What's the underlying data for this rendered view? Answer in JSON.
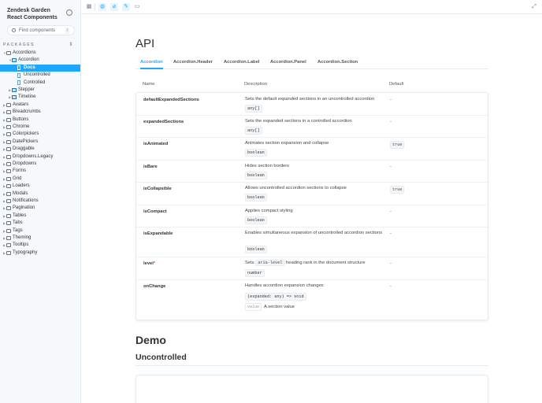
{
  "sidebar": {
    "brand_line1": "Zendesk Garden",
    "brand_line2": "React Components",
    "search_placeholder": "Find components",
    "search_shortcut": "/",
    "packages_label": "PACKAGES",
    "tree": [
      {
        "label": "Accordions",
        "kind": "folder",
        "level": 0,
        "expanded": true
      },
      {
        "label": "Accordion",
        "kind": "component",
        "level": 1,
        "expanded": true
      },
      {
        "label": "Docs",
        "kind": "doc",
        "level": 2,
        "selected": true
      },
      {
        "label": "Uncontrolled",
        "kind": "story",
        "level": 2
      },
      {
        "label": "Controlled",
        "kind": "story",
        "level": 2
      },
      {
        "label": "Stepper",
        "kind": "component",
        "level": 1
      },
      {
        "label": "Timeline",
        "kind": "component",
        "level": 1
      },
      {
        "label": "Avatars",
        "kind": "folder",
        "level": 0
      },
      {
        "label": "Breadcrumbs",
        "kind": "folder",
        "level": 0
      },
      {
        "label": "Buttons",
        "kind": "folder",
        "level": 0
      },
      {
        "label": "Chrome",
        "kind": "folder",
        "level": 0
      },
      {
        "label": "Colorpickers",
        "kind": "folder",
        "level": 0
      },
      {
        "label": "DatePickers",
        "kind": "folder",
        "level": 0
      },
      {
        "label": "Draggable",
        "kind": "folder",
        "level": 0
      },
      {
        "label": "Dropdowns.Legacy",
        "kind": "folder",
        "level": 0
      },
      {
        "label": "Dropdowns",
        "kind": "folder",
        "level": 0
      },
      {
        "label": "Forms",
        "kind": "folder",
        "level": 0
      },
      {
        "label": "Grid",
        "kind": "folder",
        "level": 0
      },
      {
        "label": "Loaders",
        "kind": "folder",
        "level": 0
      },
      {
        "label": "Modals",
        "kind": "folder",
        "level": 0
      },
      {
        "label": "Notifications",
        "kind": "folder",
        "level": 0
      },
      {
        "label": "Pagination",
        "kind": "folder",
        "level": 0
      },
      {
        "label": "Tables",
        "kind": "folder",
        "level": 0
      },
      {
        "label": "Tabs",
        "kind": "folder",
        "level": 0
      },
      {
        "label": "Tags",
        "kind": "folder",
        "level": 0
      },
      {
        "label": "Theming",
        "kind": "folder",
        "level": 0
      },
      {
        "label": "Tooltips",
        "kind": "folder",
        "level": 0
      },
      {
        "label": "Typography",
        "kind": "folder",
        "level": 0
      }
    ]
  },
  "toolbar": {
    "icons": [
      "sidebar-toggle-icon",
      "globe-icon",
      "paperclip-icon",
      "pencil-icon",
      "panel-icon",
      "fullscreen-icon"
    ]
  },
  "main": {
    "api_heading": "API",
    "tabs": [
      {
        "label": "Accordion",
        "active": true
      },
      {
        "label": "Accordion.Header"
      },
      {
        "label": "Accordion.Label"
      },
      {
        "label": "Accordion.Panel"
      },
      {
        "label": "Accordion.Section"
      }
    ],
    "columns": {
      "name": "Name",
      "description": "Description",
      "default": "Default"
    },
    "props": [
      {
        "name": "defaultExpandedSections",
        "description": "Sets the default expanded sections in an uncontrolled accordion",
        "type": "any[]",
        "default": "-"
      },
      {
        "name": "expandedSections",
        "description": "Sets the expanded sections in a controlled accordion",
        "type": "any[]",
        "default": "-"
      },
      {
        "name": "isAnimated",
        "description": "Animates section expansion and collapse",
        "type": "boolean",
        "default": "true"
      },
      {
        "name": "isBare",
        "description": "Hides section borders",
        "type": "boolean",
        "default": "-"
      },
      {
        "name": "isCollapsible",
        "description": "Allows uncontrolled accordion sections to collapse",
        "type": "boolean",
        "default": "true"
      },
      {
        "name": "isCompact",
        "description": "Applies compact styling",
        "type": "boolean",
        "default": "-"
      },
      {
        "name": "isExpandable",
        "description": "Enables simultaneous expansion of uncontrolled accordion sections",
        "type": "boolean",
        "default": "-"
      },
      {
        "name": "level",
        "required_mark": "*",
        "description_prefix": "Sets",
        "description_code": "aria-level",
        "description_suffix": "heading rank in the document structure",
        "type": "number",
        "default": "-"
      },
      {
        "name": "onChange",
        "description": "Handles accordion expansion changes",
        "type": "(expanded: any) => void",
        "arg_name": "value",
        "arg_desc": "A section value",
        "default": "-"
      }
    ],
    "demo_heading": "Demo",
    "uncontrolled_heading": "Uncontrolled"
  },
  "colors": {
    "accent": "#1ea7fd",
    "required": "#ff4785",
    "sidebar_bg": "#f6f9fc"
  }
}
